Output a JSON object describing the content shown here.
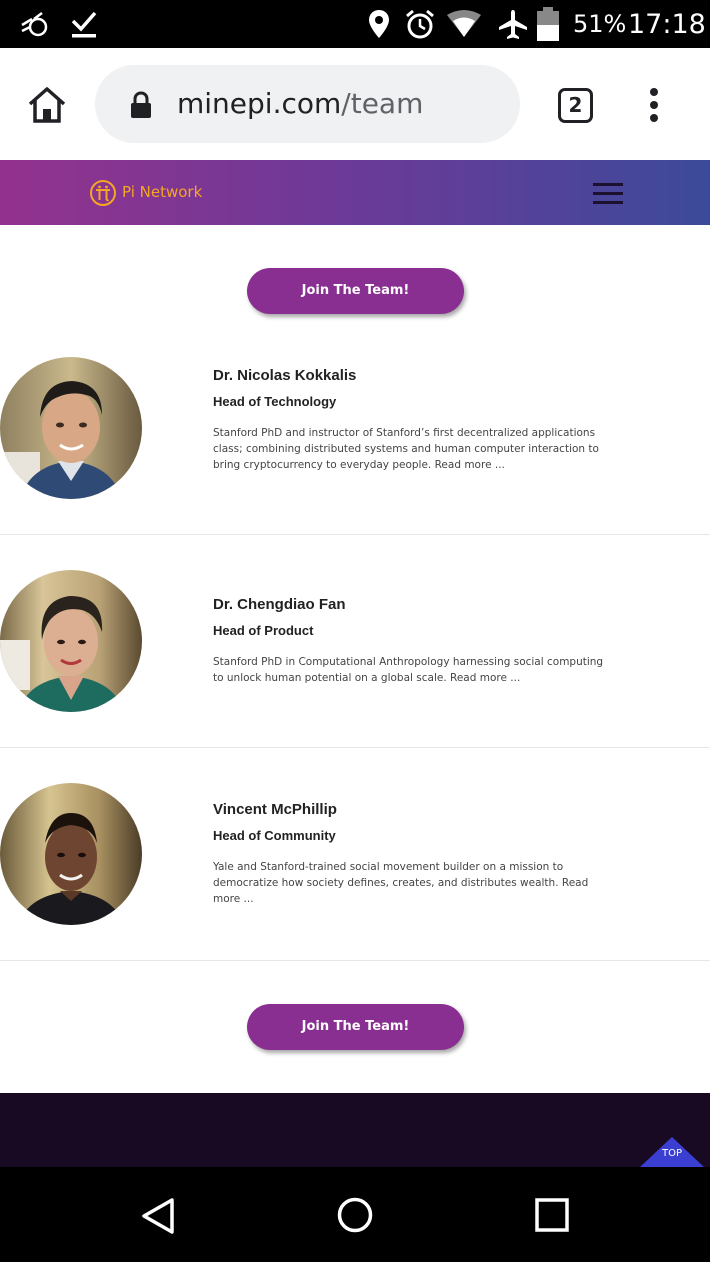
{
  "status_bar": {
    "battery": "51%",
    "time": "17:18"
  },
  "browser": {
    "url_domain": "minepi.com",
    "url_path": "/team",
    "tab_count": "2"
  },
  "site": {
    "logo_text": "Pi Network",
    "brand_color": "#f5a623",
    "join_button_label": "Join The Team!"
  },
  "members": [
    {
      "name": "Dr. Nicolas Kokkalis",
      "role": "Head of Technology",
      "bio": "Stanford PhD and instructor of Stanford’s first decentralized applications class; combining distributed systems and human computer interaction to bring cryptocurrency to everyday people. Read more ..."
    },
    {
      "name": "Dr. Chengdiao Fan",
      "role": "Head of Product",
      "bio": "Stanford PhD in Computational Anthropology harnessing social computing to unlock human potential on a global scale. Read more ..."
    },
    {
      "name": "Vincent McPhillip",
      "role": "Head of Community",
      "bio": "Yale and Stanford-trained social movement builder on a mission to democratize how society defines, creates, and distributes wealth. Read more ..."
    }
  ],
  "footer": {
    "top_label": "TOP"
  }
}
